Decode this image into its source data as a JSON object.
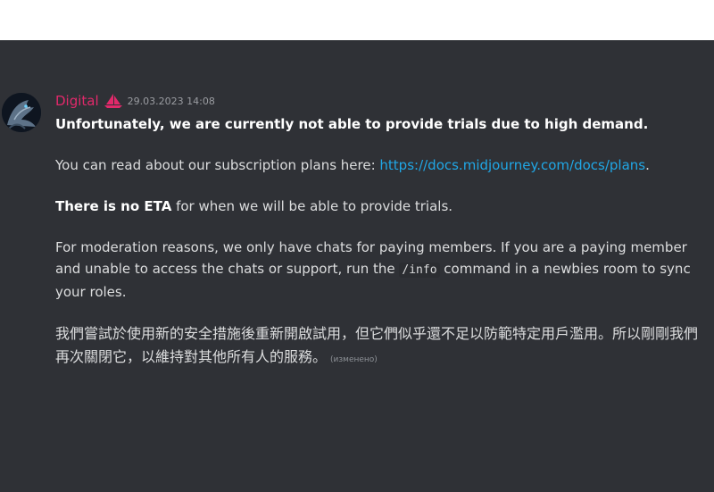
{
  "message": {
    "author": "Digital",
    "timestamp": "29.03.2023 14:08",
    "line1": "Unfortunately, we are currently not able to provide trials due to high demand.",
    "plans_prefix": "You can read about our subscription plans here: ",
    "plans_link": "https://docs.midjourney.com/docs/plans",
    "plans_suffix": ".",
    "eta_bold": "There is no ETA",
    "eta_rest": " for when we will be able to provide trials.",
    "moderation_prefix": "For moderation reasons, we only have chats for paying members. If you are a paying member and unable to access the chats or support, run the ",
    "moderation_command": "/info",
    "moderation_suffix": " command in a newbies room to sync your roles.",
    "chinese": "我們嘗試於使用新的安全措施後重新開啟試用，但它們似乎還不足以防範特定用戶濫用。所以剛剛我們再次關閉它，以維持對其他所有人的服務。",
    "edited_label": "(изменено)"
  },
  "colors": {
    "background": "#2f3136",
    "author": "#e2296b",
    "link": "#20a7e6",
    "text": "#dcddde"
  },
  "icons": {
    "role": "sailboat-icon",
    "avatar": "dragon-avatar"
  }
}
